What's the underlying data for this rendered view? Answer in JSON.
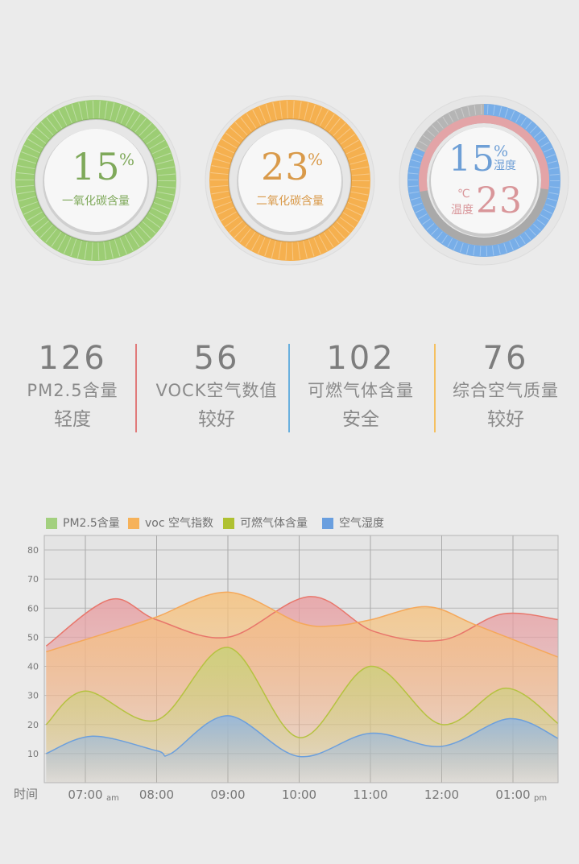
{
  "gauges": [
    {
      "value": "15",
      "unit": "%",
      "label": "一氧化碳含量",
      "color": "#9ccd74",
      "text_color": "#7fa95a"
    },
    {
      "value": "23",
      "unit": "%",
      "label": "二氧化碳含量",
      "color": "#f5b04f",
      "text_color": "#d99a4a"
    },
    {
      "humidity_value": "15",
      "humidity_unit": "%",
      "humidity_label": "湿度",
      "temp_value": "23",
      "temp_unit": "℃",
      "temp_label": "温度",
      "humidity_color": "#78aee8",
      "temp_color": "#e3a4a7",
      "humidity_fill": 0.82,
      "temp_fill": 0.55
    }
  ],
  "stats": [
    {
      "value": "126",
      "name": "PM2.5含量",
      "level": "轻度",
      "divider_color": "#e07a7a"
    },
    {
      "value": "56",
      "name": "VOCK空气数值",
      "level": "较好",
      "divider_color": "#6ab0de"
    },
    {
      "value": "102",
      "name": "可燃气体含量",
      "level": "安全",
      "divider_color": "#f5c060"
    },
    {
      "value": "76",
      "name": "综合空气质量",
      "level": "较好"
    }
  ],
  "legend": [
    {
      "label": "PM2.5含量",
      "color": "#a3d07f"
    },
    {
      "label": "voc 空气指数",
      "color": "#f6b25a"
    },
    {
      "label": "可燃气体含量",
      "color": "#afc132"
    },
    {
      "label": "空气湿度",
      "color": "#6a9fdf"
    }
  ],
  "chart_data": {
    "type": "area",
    "xlabel": "时间",
    "x": [
      "07:00",
      "08:00",
      "09:00",
      "10:00",
      "11:00",
      "12:00",
      "01:00"
    ],
    "x_suffix": [
      "am",
      "",
      "",
      "",
      "",
      "",
      "pm"
    ],
    "ylim": [
      0,
      85
    ],
    "yticks": [
      10,
      20,
      30,
      40,
      50,
      60,
      70,
      80
    ],
    "grid": true,
    "legend_position": "top-left",
    "series": [
      {
        "name": "PM2.5含量",
        "color": "#e8766b",
        "fill": "#e8a0a3",
        "points": [
          [
            -0.55,
            47
          ],
          [
            0.35,
            63
          ],
          [
            1.0,
            56
          ],
          [
            2.0,
            50
          ],
          [
            3.15,
            64
          ],
          [
            4.05,
            52
          ],
          [
            5.0,
            49
          ],
          [
            5.85,
            58
          ],
          [
            6.65,
            56
          ]
        ]
      },
      {
        "name": "voc 空气指数",
        "color": "#f5a85a",
        "fill": "#f6c27e",
        "points": [
          [
            -0.55,
            45
          ],
          [
            0.5,
            53
          ],
          [
            1.0,
            57
          ],
          [
            2.0,
            65.5
          ],
          [
            3.0,
            55
          ],
          [
            3.5,
            54
          ],
          [
            4.0,
            56
          ],
          [
            4.8,
            60.5
          ],
          [
            5.5,
            54
          ],
          [
            6.65,
            43
          ]
        ]
      },
      {
        "name": "可燃气体含量",
        "color": "#b5c240",
        "fill": "#c9d27a",
        "points": [
          [
            -0.55,
            20
          ],
          [
            0.0,
            31.5
          ],
          [
            1.0,
            21.5
          ],
          [
            2.0,
            46.5
          ],
          [
            3.0,
            15.5
          ],
          [
            4.0,
            40
          ],
          [
            5.0,
            20
          ],
          [
            5.9,
            32.5
          ],
          [
            6.65,
            20
          ]
        ]
      },
      {
        "name": "空气湿度",
        "color": "#6c9fdc",
        "fill": "#8fb5e3",
        "points": [
          [
            -0.55,
            10
          ],
          [
            0.1,
            16
          ],
          [
            1.0,
            11
          ],
          [
            1.2,
            10
          ],
          [
            2.0,
            23
          ],
          [
            3.0,
            9
          ],
          [
            4.0,
            17
          ],
          [
            5.0,
            12.5
          ],
          [
            5.95,
            22
          ],
          [
            6.65,
            15
          ]
        ]
      }
    ]
  }
}
